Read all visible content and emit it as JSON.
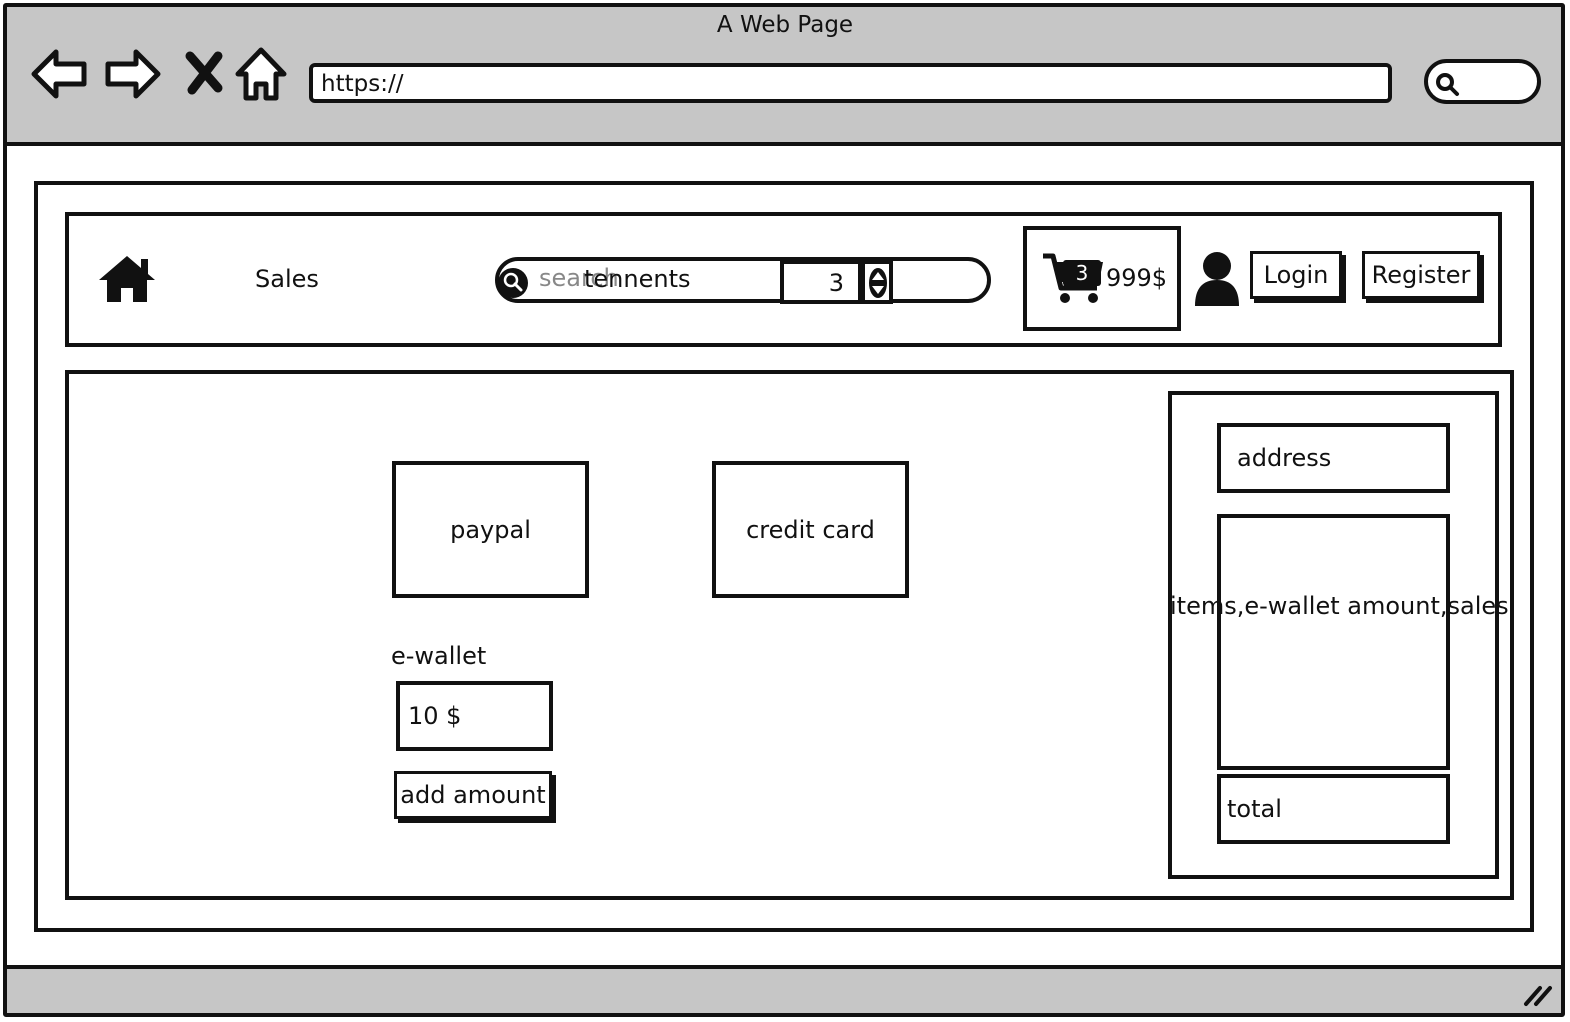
{
  "browser": {
    "window_title": "A Web Page",
    "url": "https://"
  },
  "header": {
    "nav_sales": "Sales",
    "search": {
      "placeholder": "search",
      "value": "tennents"
    },
    "quantity": "3",
    "cart": {
      "badge_count": "3",
      "total": "999$"
    },
    "login_label": "Login",
    "register_label": "Register"
  },
  "payment": {
    "paypal_label": "paypal",
    "credit_card_label": "credit card",
    "ewallet_label": "e-wallet",
    "ewallet_value": "10 $",
    "add_amount_label": "add amount"
  },
  "summary": {
    "address_label": "address",
    "items_label": "items,e-wallet amount,sales",
    "total_label": "total"
  },
  "icons": [
    "back-icon",
    "forward-icon",
    "close-icon",
    "home-icon",
    "search-icon",
    "cart-icon",
    "user-icon",
    "resize-icon"
  ]
}
